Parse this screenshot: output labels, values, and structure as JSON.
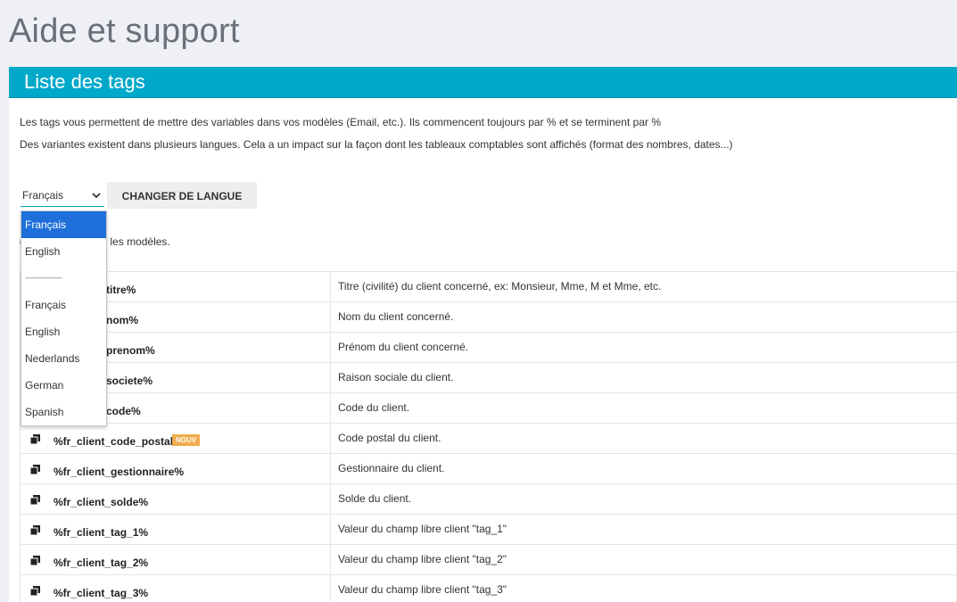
{
  "page": {
    "title": "Aide et support"
  },
  "panel": {
    "title": "Liste des tags",
    "intro_line1": "Les tags vous permettent de mettre des variables dans vos modèles (Email, etc.). Ils commencent toujours par % et se terminent par %",
    "intro_line2": "Des variantes existent dans plusieurs langues. Cela a un impact sur la façon dont les tableaux comptables sont affichés (format des nombres, dates...)",
    "subtitle_visible": "gs utilisables dans les modèles."
  },
  "language": {
    "selected": "Français",
    "button_label": "CHANGER DE LANGUE",
    "options": [
      {
        "label": "Français",
        "selected": true
      },
      {
        "label": "English",
        "selected": false
      },
      {
        "label": "-------------------",
        "separator": true
      },
      {
        "label": "Français",
        "selected": false
      },
      {
        "label": "English",
        "selected": false
      },
      {
        "label": "Nederlands",
        "selected": false
      },
      {
        "label": "German",
        "selected": false
      },
      {
        "label": "Spanish",
        "selected": false
      }
    ]
  },
  "tags": [
    {
      "tag": "titre%",
      "description": "Titre (civilité) du client concerné, ex: Monsieur, Mme, M et Mme, etc.",
      "partial": true
    },
    {
      "tag": "nom%",
      "description": "Nom du client concerné.",
      "partial": true
    },
    {
      "tag": "prenom%",
      "description": "Prénom du client concerné.",
      "partial": true
    },
    {
      "tag": "societe%",
      "description": "Raison sociale du client.",
      "partial": true
    },
    {
      "tag": "code%",
      "description": "Code du client.",
      "partial": true
    },
    {
      "tag": "%fr_client_code_postal%",
      "description": "Code postal du client.",
      "badge": "NOUV"
    },
    {
      "tag": "%fr_client_gestionnaire%",
      "description": "Gestionnaire du client."
    },
    {
      "tag": "%fr_client_solde%",
      "description": "Solde du client."
    },
    {
      "tag": "%fr_client_tag_1%",
      "description": "Valeur du champ libre client \"tag_1\""
    },
    {
      "tag": "%fr_client_tag_2%",
      "description": "Valeur du champ libre client \"tag_2\""
    },
    {
      "tag": "%fr_client_tag_3%",
      "description": "Valeur du champ libre client \"tag_3\""
    }
  ],
  "colors": {
    "accent": "#00a9c9",
    "selected_option": "#1e6fd9",
    "badge": "#f0ad4e"
  },
  "icons": {
    "copy": "copy-icon",
    "select_arrow": "chevron-down-icon"
  }
}
